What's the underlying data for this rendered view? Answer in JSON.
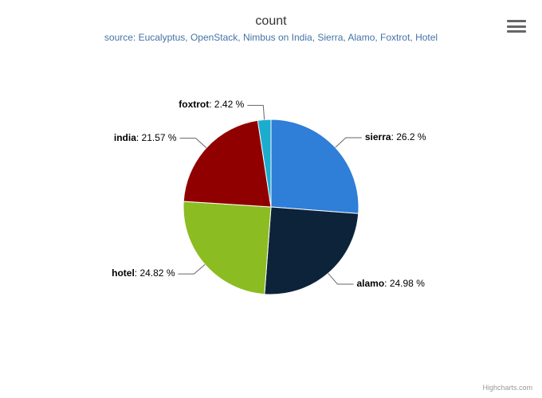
{
  "title": "count",
  "subtitle": "source: Eucalyptus, OpenStack, Nimbus on India, Sierra, Alamo, Foxtrot, Hotel",
  "credits": "Highcharts.com",
  "hamburger_name": "chart-context-menu",
  "chart_data": {
    "type": "pie",
    "title": "count",
    "series": [
      {
        "name": "sierra",
        "value": 26.2,
        "color": "#2f7ed8",
        "label": "sierra",
        "pct": "26.2 %"
      },
      {
        "name": "alamo",
        "value": 24.98,
        "color": "#0d233a",
        "label": "alamo",
        "pct": "24.98 %"
      },
      {
        "name": "hotel",
        "value": 24.82,
        "color": "#8bbc21",
        "label": "hotel",
        "pct": "24.82 %"
      },
      {
        "name": "india",
        "value": 21.57,
        "color": "#910000",
        "label": "india",
        "pct": "21.57 %"
      },
      {
        "name": "foxtrot",
        "value": 2.42,
        "color": "#1aadce",
        "label": "foxtrot",
        "pct": "2.42 %"
      }
    ]
  }
}
